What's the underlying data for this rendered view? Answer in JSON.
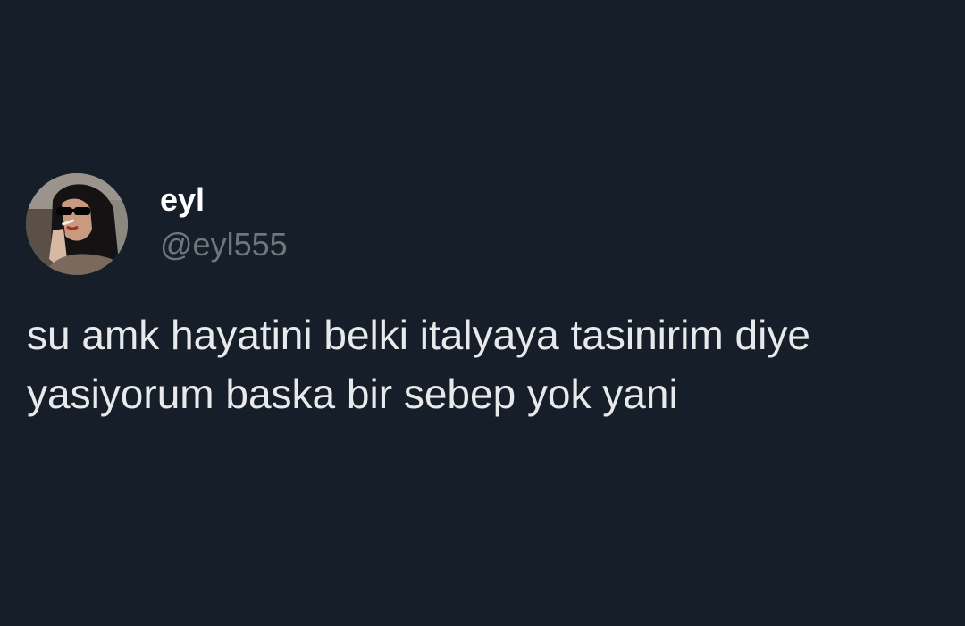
{
  "user": {
    "display_name": "eyl",
    "handle": "@eyl555",
    "avatar_icon": "profile-photo"
  },
  "tweet": {
    "text": "su amk hayatini belki italyaya tasinirim diye yasiyorum baska bir sebep yok yani"
  },
  "colors": {
    "background": "#161f29",
    "text_primary": "#e7e9ea",
    "text_secondary": "#71767b"
  }
}
